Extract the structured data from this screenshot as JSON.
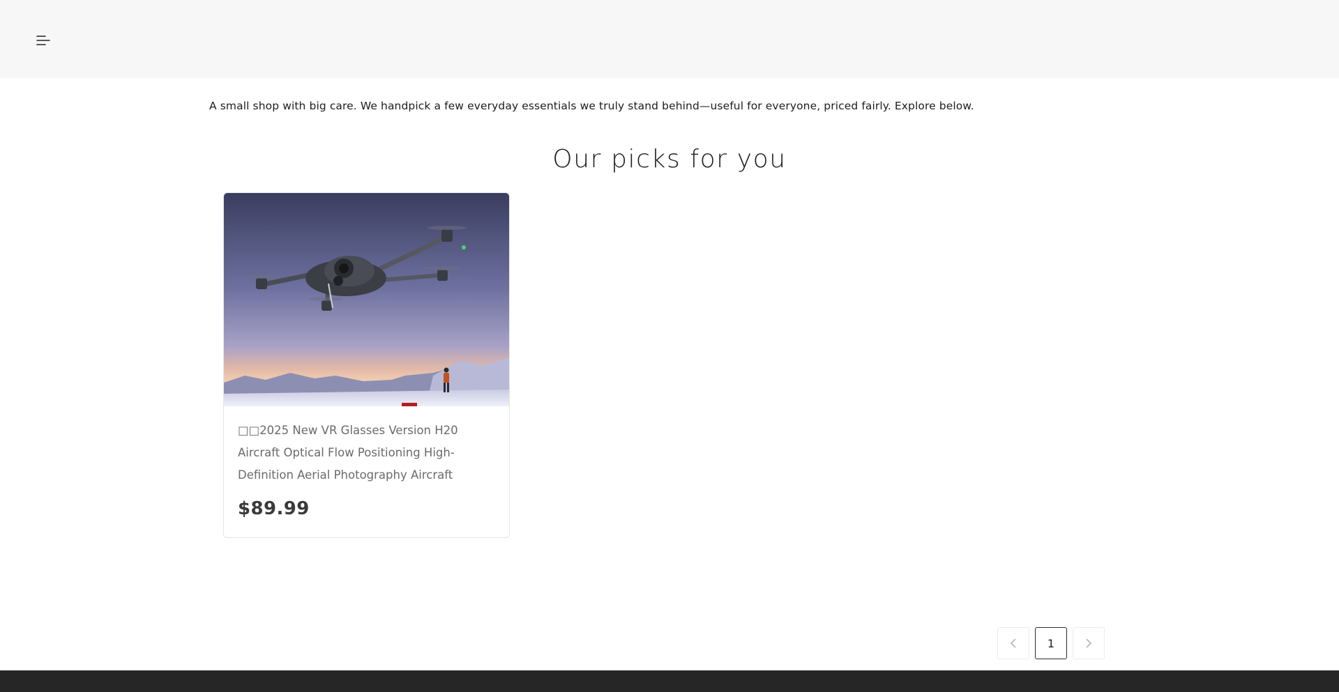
{
  "header": {
    "menu_icon": "menu-icon"
  },
  "intro": {
    "text": "A small shop with big care. We handpick a few everyday essentials we truly stand behind—useful for everyone, priced fairly. Explore below."
  },
  "section": {
    "title": "Our picks for you"
  },
  "products": [
    {
      "name": "2025 New VR Glasses Version H20 Aircraft Optical Flow Positioning High-Definition Aerial Photography Aircraft",
      "name_prefix_glyphs": "□□",
      "price": "$89.99",
      "image_icon": "drone-photo"
    }
  ],
  "pagination": {
    "prev_icon": "chevron-left-icon",
    "current_page": "1",
    "next_icon": "chevron-right-icon"
  },
  "colors": {
    "header_bg": "#f7f7f7",
    "footer_bg": "#262626",
    "price": "#3a3a3a",
    "product_name": "#6a6a6a"
  }
}
